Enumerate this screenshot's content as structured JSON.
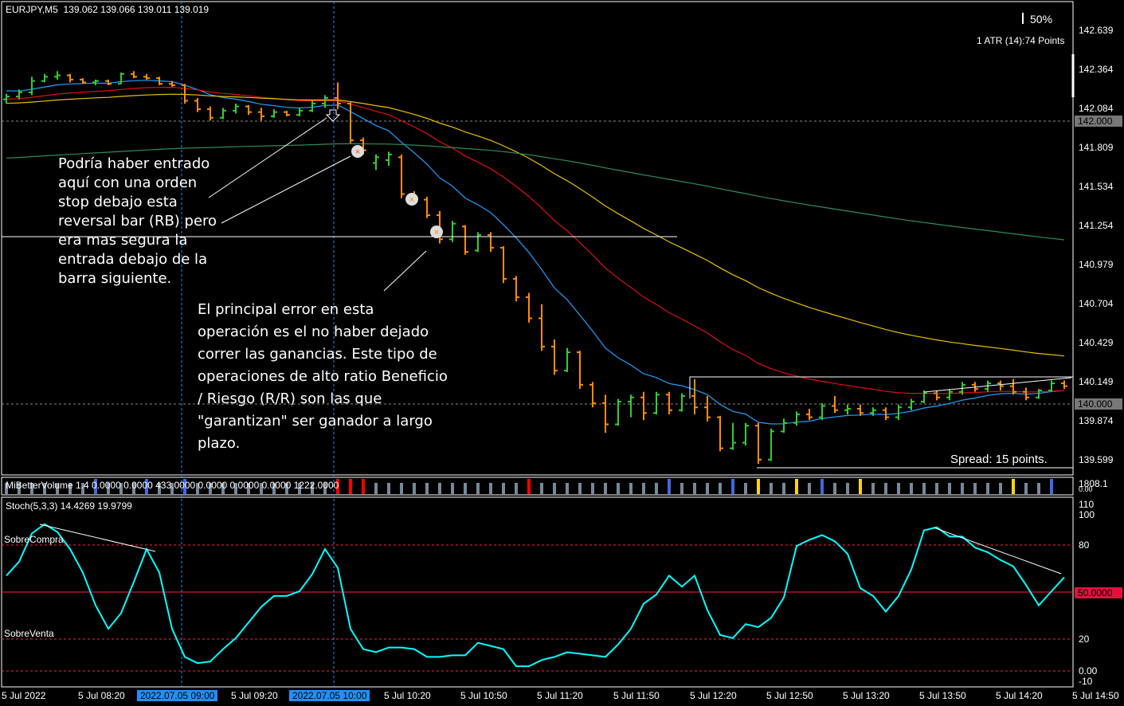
{
  "header": {
    "symbol": "EURJPY,M5",
    "ohlc": "139.062 139.066 139.011 139.019"
  },
  "overlay": {
    "zoom_percent": "50%",
    "atr": "1 ATR (14):74 Points",
    "spread": "Spread: 15 points."
  },
  "price_axis": [
    "142.639",
    "142.364",
    "142.084",
    "141.809",
    "141.534",
    "141.254",
    "140.979",
    "140.704",
    "140.429",
    "140.149",
    "139.874",
    "139.599"
  ],
  "price_boxes": [
    "142.000",
    "140.000"
  ],
  "annotations": {
    "entry_note": "Podría haber entrado\naquí con una orden\nstop debajo esta\nreversal bar (RB) pero\nera mas segura la\nentrada debajo de la\nbarra siguiente.",
    "error_note": "El principal error en esta\noperación es el no haber dejado\ncorrer las ganancias. Este tipo de\noperaciones de alto ratio Beneficio\n/ Riesgo (R/R) son las que\n\"garantizan\" ser  ganador a largo\nplazo."
  },
  "volume_indicator": {
    "label": "MiBetterVolume 1.4 0.0000 0.0000 433.0000 0.0000 0.0000 0.0000 1222.0000",
    "axis_top": "1808.1",
    "axis_bottom": "0.00"
  },
  "stoch": {
    "label": "Stoch(5,3,3) 14.4269 19.9799",
    "overbought": "SobreCompra",
    "oversold": "SobreVenta",
    "axis": {
      "v110": "110",
      "v100": "100",
      "v80": "80",
      "v50": "50.0000",
      "v20": "20",
      "v0": "0.00",
      "vm10": "-10"
    },
    "values": [
      61,
      70,
      88,
      94,
      89,
      78,
      63,
      42,
      27,
      37,
      57,
      78,
      63,
      27,
      9,
      5,
      6,
      14,
      21,
      31,
      41,
      48,
      48,
      51,
      62,
      78,
      66,
      27,
      14,
      12,
      15,
      15,
      14,
      9,
      9,
      10,
      10,
      18,
      16,
      14,
      3,
      3,
      7,
      9,
      12,
      11,
      10,
      9,
      17,
      27,
      43,
      49,
      61,
      54,
      61,
      39,
      23,
      21,
      30,
      28,
      34,
      47,
      80,
      84,
      87,
      83,
      75,
      53,
      48,
      38,
      48,
      65,
      90,
      92,
      86,
      86,
      79,
      76,
      71,
      67,
      55,
      42,
      51,
      60
    ]
  },
  "time_axis": [
    {
      "t": "5 Jul 2022",
      "h": false
    },
    {
      "t": "5 Jul 08:20",
      "h": false
    },
    {
      "t": "2022.07.05 09:00",
      "h": true
    },
    {
      "t": "5 Jul 09:20",
      "h": false
    },
    {
      "t": "2022.07.05 10:00",
      "h": true
    },
    {
      "t": "5 Jul 10:20",
      "h": false
    },
    {
      "t": "5 Jul 10:50",
      "h": false
    },
    {
      "t": "5 Jul 11:20",
      "h": false
    },
    {
      "t": "5 Jul 11:50",
      "h": false
    },
    {
      "t": "5 Jul 12:20",
      "h": false
    },
    {
      "t": "5 Jul 12:50",
      "h": false
    },
    {
      "t": "5 Jul 13:20",
      "h": false
    },
    {
      "t": "5 Jul 13:50",
      "h": false
    },
    {
      "t": "5 Jul 14:20",
      "h": false
    },
    {
      "t": "5 Jul 14:50",
      "h": false
    }
  ],
  "colors": {
    "up": "#32cd32",
    "down": "#ff8c00",
    "stoch": "#00ffff",
    "level": "#ff2040",
    "vol": "#778899"
  },
  "chart_data": {
    "type": "ohlc",
    "title": "EURJPY,M5",
    "ylim": [
      139.599,
      142.639
    ],
    "bars": [
      [
        142.15,
        142.19,
        142.12,
        142.17
      ],
      [
        142.17,
        142.22,
        142.15,
        142.2
      ],
      [
        142.2,
        142.31,
        142.18,
        142.28
      ],
      [
        142.28,
        142.33,
        142.27,
        142.31
      ],
      [
        142.31,
        142.35,
        142.29,
        142.32
      ],
      [
        142.32,
        142.33,
        142.27,
        142.29
      ],
      [
        142.29,
        142.3,
        142.26,
        142.27
      ],
      [
        142.27,
        142.29,
        142.25,
        142.28
      ],
      [
        142.28,
        142.29,
        142.25,
        142.26
      ],
      [
        142.26,
        142.34,
        142.26,
        142.33
      ],
      [
        142.33,
        142.35,
        142.3,
        142.31
      ],
      [
        142.31,
        142.33,
        142.29,
        142.3
      ],
      [
        142.3,
        142.31,
        142.25,
        142.26
      ],
      [
        142.26,
        142.28,
        142.24,
        142.25
      ],
      [
        142.25,
        142.26,
        142.12,
        142.14
      ],
      [
        142.14,
        142.16,
        142.06,
        142.08
      ],
      [
        142.08,
        142.1,
        142.0,
        142.02
      ],
      [
        142.02,
        142.09,
        142.01,
        142.07
      ],
      [
        142.07,
        142.12,
        142.05,
        142.1
      ],
      [
        142.1,
        142.11,
        142.04,
        142.06
      ],
      [
        142.06,
        142.09,
        142.0,
        142.03
      ],
      [
        142.03,
        142.08,
        142.02,
        142.06
      ],
      [
        142.06,
        142.07,
        142.03,
        142.04
      ],
      [
        142.04,
        142.09,
        142.03,
        142.07
      ],
      [
        142.07,
        142.14,
        142.06,
        142.12
      ],
      [
        142.12,
        142.18,
        142.09,
        142.16
      ],
      [
        142.16,
        142.27,
        142.08,
        142.12
      ],
      [
        142.12,
        142.13,
        141.84,
        141.86
      ],
      [
        141.86,
        141.88,
        141.76,
        141.79
      ],
      [
        141.7,
        141.76,
        141.65,
        141.74
      ],
      [
        141.72,
        141.78,
        141.68,
        141.76
      ],
      [
        141.74,
        141.76,
        141.45,
        141.48
      ],
      [
        141.48,
        141.5,
        141.42,
        141.44
      ],
      [
        141.44,
        141.46,
        141.31,
        141.33
      ],
      [
        141.33,
        141.36,
        141.13,
        141.16
      ],
      [
        141.16,
        141.29,
        141.14,
        141.27
      ],
      [
        141.25,
        141.26,
        141.05,
        141.07
      ],
      [
        141.08,
        141.21,
        141.07,
        141.19
      ],
      [
        141.19,
        141.21,
        141.07,
        141.1
      ],
      [
        141.1,
        141.11,
        140.85,
        140.88
      ],
      [
        140.88,
        140.9,
        140.72,
        140.75
      ],
      [
        140.75,
        140.78,
        140.57,
        140.6
      ],
      [
        140.6,
        140.7,
        140.37,
        140.4
      ],
      [
        140.4,
        140.45,
        140.2,
        140.23
      ],
      [
        140.23,
        140.39,
        140.22,
        140.36
      ],
      [
        140.36,
        140.37,
        140.1,
        140.13
      ],
      [
        140.13,
        140.15,
        139.97,
        140.0
      ],
      [
        140.0,
        140.06,
        139.79,
        139.85
      ],
      [
        139.85,
        140.03,
        139.84,
        140.01
      ],
      [
        140.01,
        140.06,
        139.9,
        140.04
      ],
      [
        140.04,
        140.08,
        139.88,
        139.93
      ],
      [
        139.93,
        140.08,
        139.92,
        140.06
      ],
      [
        140.06,
        140.08,
        139.92,
        139.95
      ],
      [
        139.95,
        140.07,
        139.94,
        140.05
      ],
      [
        140.05,
        140.17,
        139.92,
        139.97
      ],
      [
        139.97,
        140.05,
        139.87,
        139.9
      ],
      [
        139.9,
        139.91,
        139.66,
        139.68
      ],
      [
        139.68,
        139.86,
        139.67,
        139.72
      ],
      [
        139.72,
        139.86,
        139.7,
        139.84
      ],
      [
        139.84,
        139.86,
        139.57,
        139.6
      ],
      [
        139.6,
        139.82,
        139.59,
        139.8
      ],
      [
        139.8,
        139.89,
        139.79,
        139.86
      ],
      [
        139.86,
        139.94,
        139.84,
        139.92
      ],
      [
        139.92,
        139.96,
        139.88,
        139.9
      ],
      [
        139.9,
        140.0,
        139.88,
        139.98
      ],
      [
        139.98,
        140.05,
        139.93,
        139.95
      ],
      [
        139.95,
        139.99,
        139.92,
        139.96
      ],
      [
        139.96,
        139.99,
        139.91,
        139.93
      ],
      [
        139.93,
        139.97,
        139.91,
        139.95
      ],
      [
        139.95,
        139.97,
        139.88,
        139.9
      ],
      [
        139.9,
        139.99,
        139.88,
        139.97
      ],
      [
        139.97,
        140.03,
        139.95,
        140.01
      ],
      [
        140.01,
        140.09,
        140.0,
        140.07
      ],
      [
        140.07,
        140.09,
        140.02,
        140.04
      ],
      [
        140.04,
        140.1,
        140.02,
        140.08
      ],
      [
        140.08,
        140.15,
        140.06,
        140.13
      ],
      [
        140.13,
        140.15,
        140.08,
        140.1
      ],
      [
        140.1,
        140.16,
        140.08,
        140.14
      ],
      [
        140.14,
        140.16,
        140.09,
        140.12
      ],
      [
        140.12,
        140.17,
        140.06,
        140.08
      ],
      [
        140.08,
        140.11,
        140.02,
        140.04
      ],
      [
        140.04,
        140.1,
        140.03,
        140.09
      ],
      [
        140.09,
        140.16,
        140.08,
        140.14
      ],
      [
        140.14,
        140.16,
        140.1,
        140.12
      ]
    ],
    "moving_averages": [
      {
        "period": 10,
        "seed": 142.22,
        "color": "#1e9fff"
      },
      {
        "period": 25,
        "seed": 142.15,
        "color": "#e01010"
      },
      {
        "period": 50,
        "seed": 142.12,
        "color": "#e6c000"
      },
      {
        "period": 200,
        "seed": 141.73,
        "color": "#2e8b57"
      }
    ],
    "volume_colors": "gggggggbgggbggbgggggggggggrrrggggggggggggrggggggggggbggggbgyggygbggygggggggggggyggb"
  }
}
